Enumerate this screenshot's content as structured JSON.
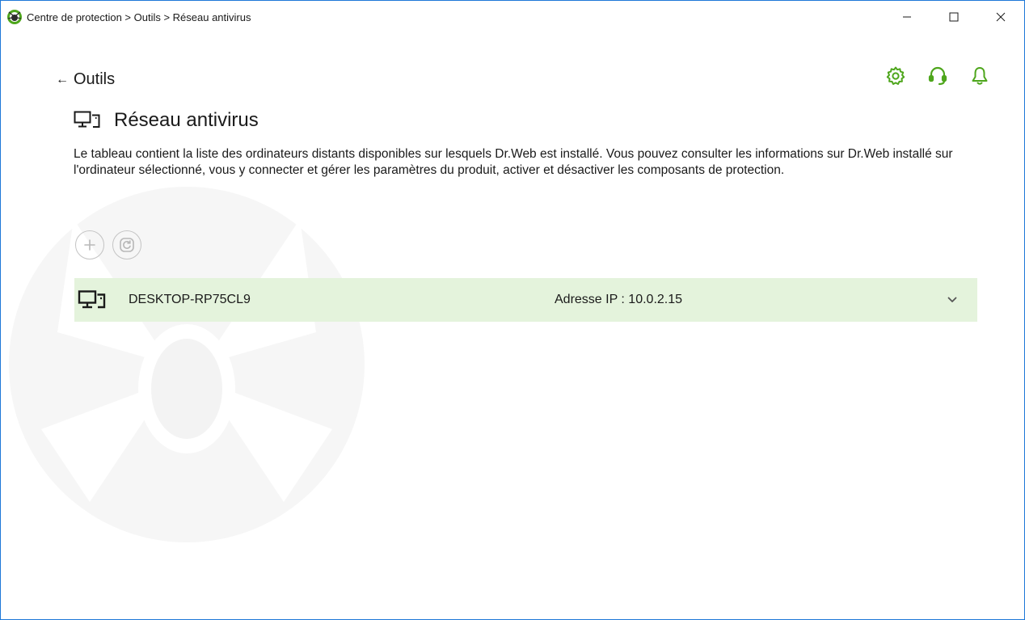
{
  "window": {
    "title": "Centre de protection > Outils > Réseau antivirus",
    "controls": {
      "minimize_icon": "minimize-icon",
      "maximize_icon": "maximize-icon",
      "close_icon": "close-icon"
    }
  },
  "nav": {
    "back_arrow": "←",
    "back_label": "Outils"
  },
  "header_icons": [
    "settings-gear-icon",
    "support-headset-icon",
    "notifications-bell-icon"
  ],
  "page": {
    "title": "Réseau antivirus",
    "description": "Le tableau contient la liste des ordinateurs distants disponibles sur lesquels Dr.Web est installé. Vous pouvez consulter les informations sur Dr.Web installé sur l'ordinateur sélectionné, vous y connecter et gérer les paramètres du produit, activer et désactiver les composants de protection."
  },
  "actions": [
    "add-icon",
    "refresh-icon"
  ],
  "computers": [
    {
      "name": "DESKTOP-RP75CL9",
      "ip_text": "Adresse IP : 10.0.2.15",
      "expanded": false
    }
  ],
  "colors": {
    "accent_green": "#4ea61c",
    "row_selected_bg": "#e4f3dc",
    "disabled_gray": "#c4c4c4",
    "window_border": "#1e78d8"
  }
}
